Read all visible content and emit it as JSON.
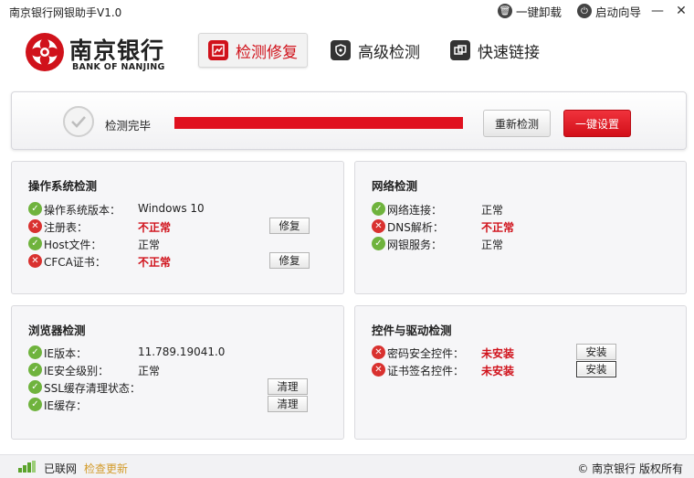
{
  "window": {
    "title": "南京银行网银助手V1.0",
    "uninstall_label": "一键卸载",
    "wizard_label": "启动向导",
    "minimize": "—",
    "close": "✕"
  },
  "brand": {
    "name_cn": "南京银行",
    "name_en": "BANK OF NANJING",
    "color": "#d0121b"
  },
  "nav": {
    "tabs": [
      {
        "label": "检测修复",
        "active": true
      },
      {
        "label": "高级检测",
        "active": false
      },
      {
        "label": "快速链接",
        "active": false
      }
    ]
  },
  "status": {
    "text": "检测完毕",
    "progress_percent": 100,
    "rescan_label": "重新检测",
    "onekey_label": "一键设置"
  },
  "sections": {
    "os": {
      "title": "操作系统检测",
      "rows": [
        {
          "label": "操作系统版本：",
          "value": "Windows 10",
          "ok": true,
          "action": ""
        },
        {
          "label": "注册表：",
          "value": "不正常",
          "ok": false,
          "action": "修复"
        },
        {
          "label": "Host文件：",
          "value": "正常",
          "ok": true,
          "action": ""
        },
        {
          "label": "CFCA证书：",
          "value": "不正常",
          "ok": false,
          "action": "修复"
        }
      ]
    },
    "network": {
      "title": "网络检测",
      "rows": [
        {
          "label": "网络连接：",
          "value": "正常",
          "ok": true
        },
        {
          "label": "DNS解析：",
          "value": "不正常",
          "ok": false
        },
        {
          "label": "网银服务：",
          "value": "正常",
          "ok": true
        }
      ]
    },
    "browser": {
      "title": "浏览器检测",
      "rows": [
        {
          "label": "IE版本：",
          "value": "11.789.19041.0",
          "ok": true,
          "action": ""
        },
        {
          "label": "IE安全级别：",
          "value": "正常",
          "ok": true,
          "action": ""
        },
        {
          "label": "SSL缓存清理状态：",
          "value": "",
          "ok": true,
          "action": "清理"
        },
        {
          "label": "IE缓存：",
          "value": "",
          "ok": true,
          "action": "清理"
        }
      ]
    },
    "controls": {
      "title": "控件与驱动检测",
      "rows": [
        {
          "label": "密码安全控件：",
          "value": "未安装",
          "ok": false,
          "action": "安装"
        },
        {
          "label": "证书签名控件：",
          "value": "未安装",
          "ok": false,
          "action": "安装"
        }
      ]
    }
  },
  "footer": {
    "net_status": "已联网",
    "update_label": "检查更新",
    "copyright": "© 南京银行 版权所有"
  },
  "icons": {
    "ok": "check-icon",
    "bad": "cross-icon"
  },
  "colors": {
    "accent_red": "#d0121b",
    "ok_green": "#6fb33d",
    "error_red": "#d9312f",
    "update_link": "#d39b2a"
  }
}
